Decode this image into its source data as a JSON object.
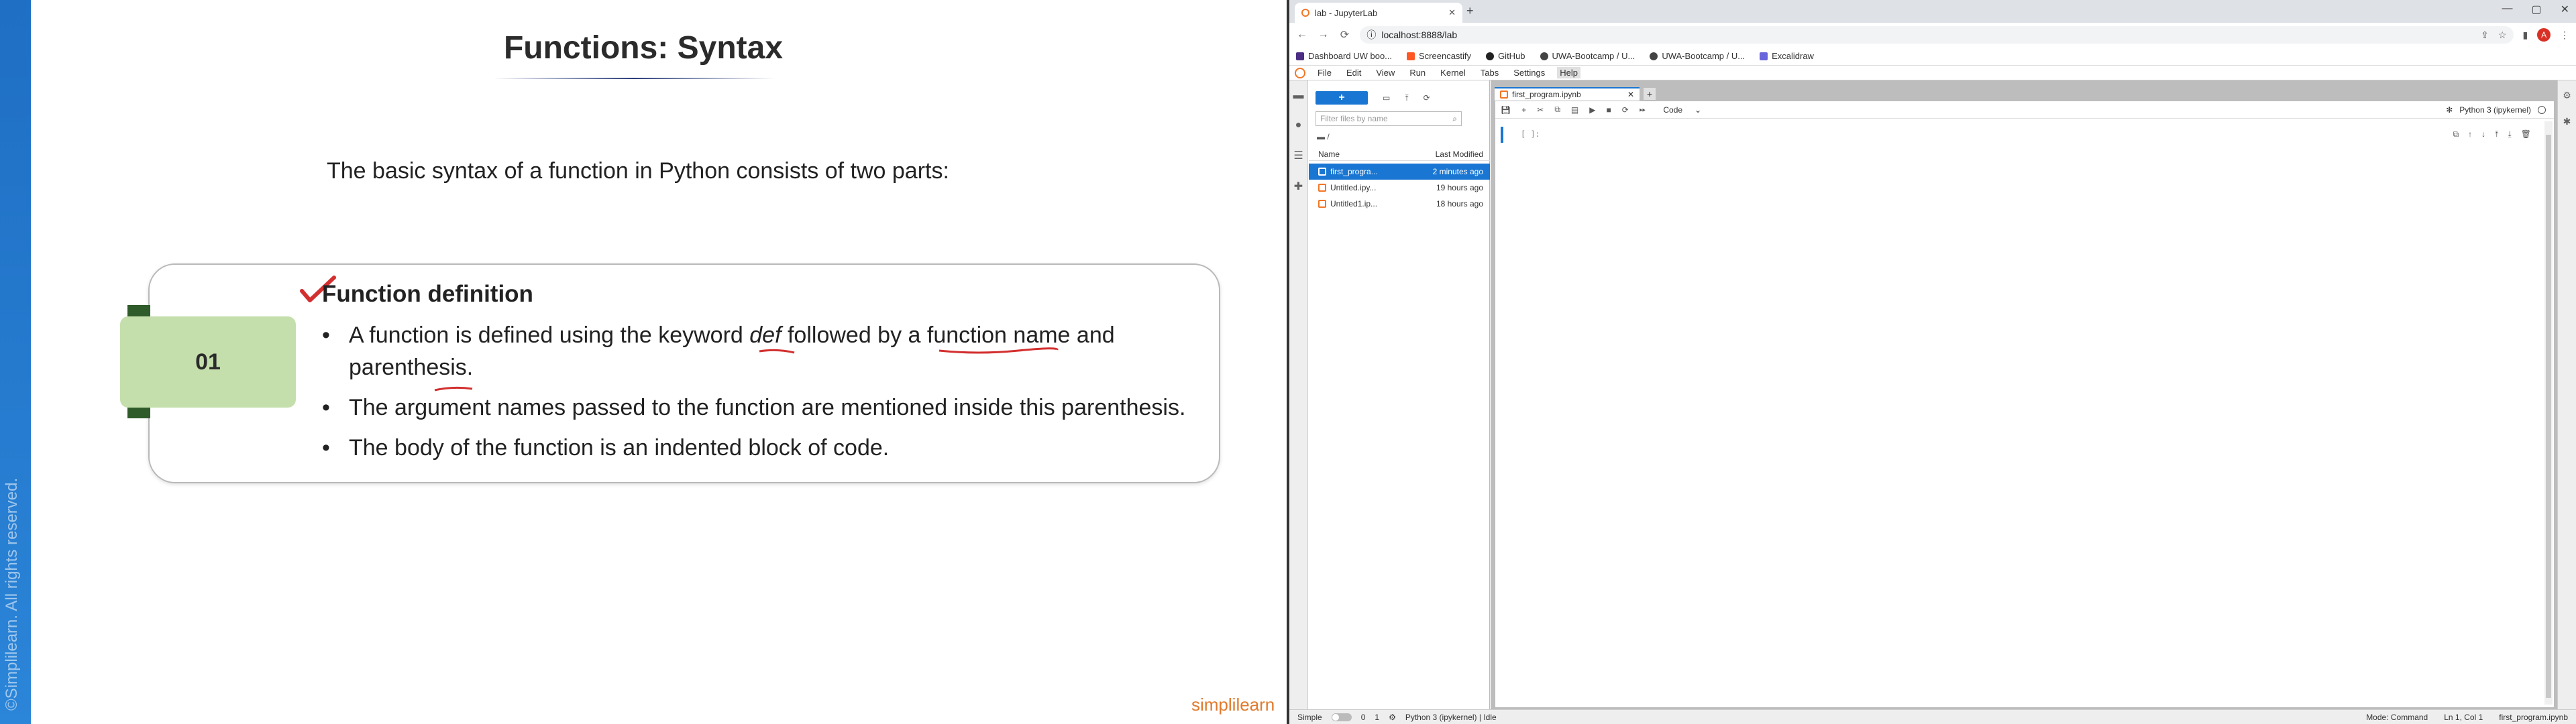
{
  "slide": {
    "title": "Functions: Syntax",
    "intro": "The basic syntax of a function in Python consists of two parts:",
    "number": "01",
    "heading": "Function definition",
    "bullets": [
      "A function is defined using the keyword def followed by a function name and parenthesis.",
      "The argument names passed to the function are mentioned inside this parenthesis.",
      "The body of the function is an indented block of code."
    ],
    "b1_parts": [
      "A function is defined using the keyword ",
      "def",
      " followed by a function name and parenthesis."
    ],
    "copyright": "©Simplilearn. All rights reserved.",
    "logo": "simplilearn",
    "colors": {
      "sidebar": "#2b85d8",
      "number_box": "#c5dfac",
      "tab_mark": "#2f5b2a",
      "annotation": "#d32f2f"
    }
  },
  "browser": {
    "tab_title": "lab - JupyterLab",
    "tab_close": "✕",
    "new_tab": "+",
    "win_controls": [
      "—",
      "▢",
      "✕"
    ],
    "nav": {
      "back": "←",
      "forward": "→",
      "reload": "⟳"
    },
    "url": "localhost:8888/lab",
    "profile_initial": "A",
    "bookmarks": [
      {
        "label": "Dashboard UW boo...",
        "color": "#4b2e83"
      },
      {
        "label": "Screencastify",
        "color": "#ff5722"
      },
      {
        "label": "GitHub",
        "color": "#222222"
      },
      {
        "label": "UWA-Bootcamp / U...",
        "color": "#444444"
      },
      {
        "label": "UWA-Bootcamp / U...",
        "color": "#444444"
      },
      {
        "label": "Excalidraw",
        "color": "#6965db"
      }
    ]
  },
  "jupyter": {
    "menus": [
      "File",
      "Edit",
      "View",
      "Run",
      "Kernel",
      "Tabs",
      "Settings",
      "Help"
    ],
    "active_menu": "Help",
    "filebrowser": {
      "new_label": "+",
      "filter_placeholder": "Filter files by name",
      "breadcrumb": "/",
      "col_name": "Name",
      "col_modified": "Last Modified",
      "files": [
        {
          "name": "first_progra...",
          "modified": "2 minutes ago",
          "selected": true
        },
        {
          "name": "Untitled.ipy...",
          "modified": "19 hours ago",
          "selected": false
        },
        {
          "name": "Untitled1.ip...",
          "modified": "18 hours ago",
          "selected": false
        }
      ]
    },
    "doc_tab": "first_program.ipynb",
    "doc_tab_close": "✕",
    "add_tab": "+",
    "cell_type": "Code",
    "kernel": "Python 3 (ipykernel)",
    "cell_prompt": "[ ]:",
    "status": {
      "mode_label": "Simple",
      "count1": "0",
      "count2": "1",
      "kernel_state": "Python 3 (ipykernel) | Idle",
      "mode": "Mode: Command",
      "position": "Ln 1, Col 1",
      "filename": "first_program.ipynb"
    }
  }
}
